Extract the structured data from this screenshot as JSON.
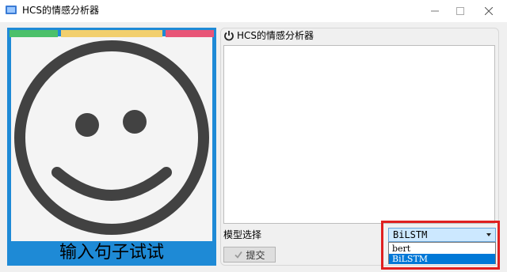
{
  "window": {
    "title": "HCS的情感分析器",
    "controls": {
      "minimize": "minimize-icon",
      "maximize": "maximize-icon",
      "close": "close-icon"
    }
  },
  "left_panel": {
    "caption": "输入句子试试",
    "strip_colors": [
      "#4cc06a",
      "#f2cf6d",
      "#e85577"
    ],
    "accent": "#1e8ad6"
  },
  "right_panel": {
    "title": "HCS的情感分析器",
    "text_area_value": "",
    "model_label": "模型选择",
    "submit_label": "提交",
    "model_select": {
      "selected": "BiLSTM",
      "options": [
        "bert",
        "BiLSTM"
      ],
      "highlighted_option": "BiLSTM"
    }
  },
  "colors": {
    "highlight_box": "#e02020",
    "selection": "#0078d7"
  }
}
